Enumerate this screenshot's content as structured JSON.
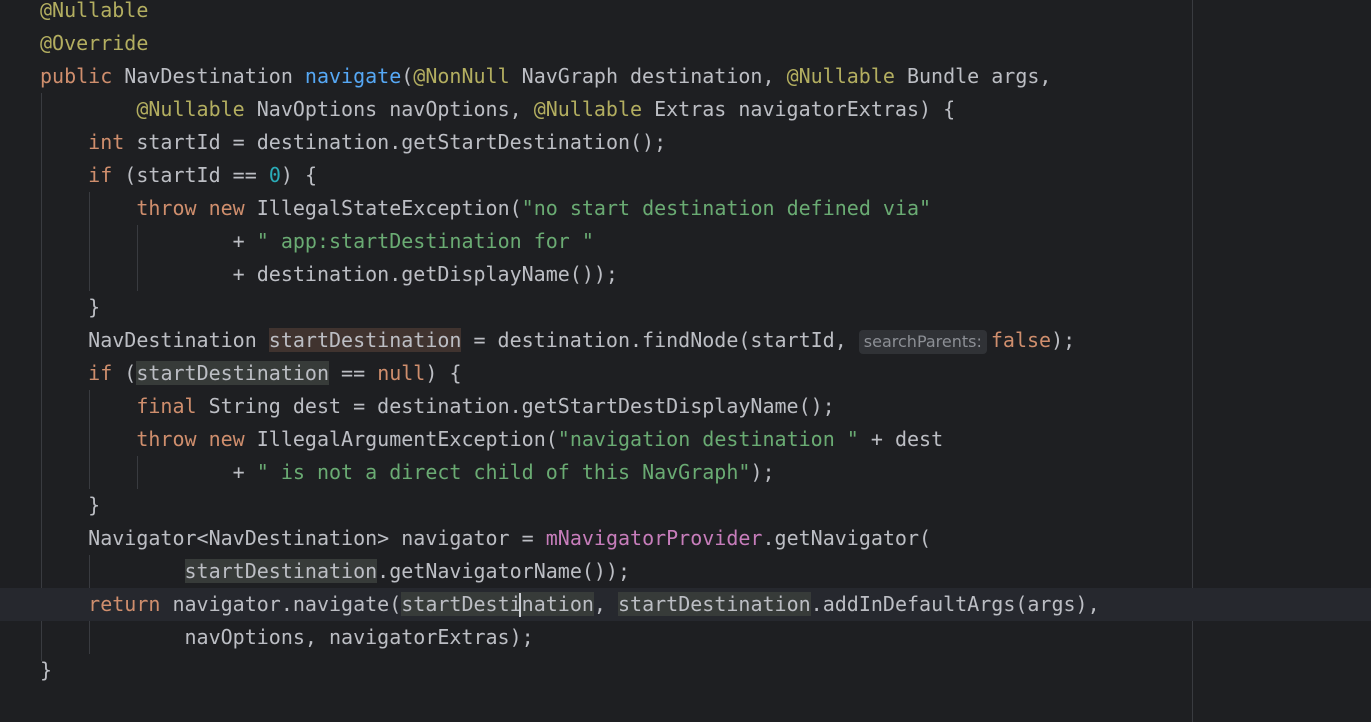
{
  "editor": {
    "tokens": {
      "nullable": "@Nullable",
      "override": "@Override",
      "nonnull": "@NonNull",
      "public": "public",
      "int": "int",
      "if": "if",
      "throw": "throw",
      "new": "new",
      "final": "final",
      "null": "null",
      "false": "false",
      "return": "return",
      "zero": "0",
      "start_destination": "startDestination",
      "field_provider": "mNavigatorProvider",
      "method_navigate": "navigate"
    },
    "text": {
      "l3_a": " NavDestination ",
      "l3_b": "(",
      "l3_c": " NavGraph destination, ",
      "l3_d": " Bundle args,",
      "l4_a": "        ",
      "l4_b": " NavOptions navOptions, ",
      "l4_c": " Extras navigatorExtras) {",
      "l5_a": "    ",
      "l5_b": " startId = destination.getStartDestination();",
      "l6_a": "    ",
      "l6_b": " (startId == ",
      "l6_c": ") {",
      "l7_a": "        ",
      "l7_b": " IllegalStateException(",
      "l7_str": "\"no start destination defined via\"",
      "l8_a": "                + ",
      "l8_str": "\" app:startDestination for \"",
      "l9": "                + destination.getDisplayName());",
      "l10": "    }",
      "l11_a": "    NavDestination ",
      "l11_b": " = destination.findNode(startId, ",
      "l11_hint": "searchParents:",
      "l11_c": ");",
      "l12_a": "    ",
      "l12_b": " (",
      "l12_c": " == ",
      "l12_d": ") {",
      "l13_a": "        ",
      "l13_b": " String dest = destination.getStartDestDisplayName();",
      "l14_a": "        ",
      "l14_b": " IllegalArgumentException(",
      "l14_str": "\"navigation destination \"",
      "l14_c": " + dest",
      "l15_a": "                + ",
      "l15_str": "\" is not a direct child of this NavGraph\"",
      "l15_b": ");",
      "l16": "    }",
      "l17_a": "    Navigator<NavDestination> navigator = ",
      "l17_b": ".getNavigator(",
      "l18_a": "            ",
      "l18_b": ".getNavigatorName());",
      "l19_a": "    ",
      "l19_b": " navigator.navigate(",
      "l19_c": ", ",
      "l19_d": ".addInDefaultArgs(args),",
      "l20": "            navOptions, navigatorExtras);",
      "l21": "}"
    }
  }
}
